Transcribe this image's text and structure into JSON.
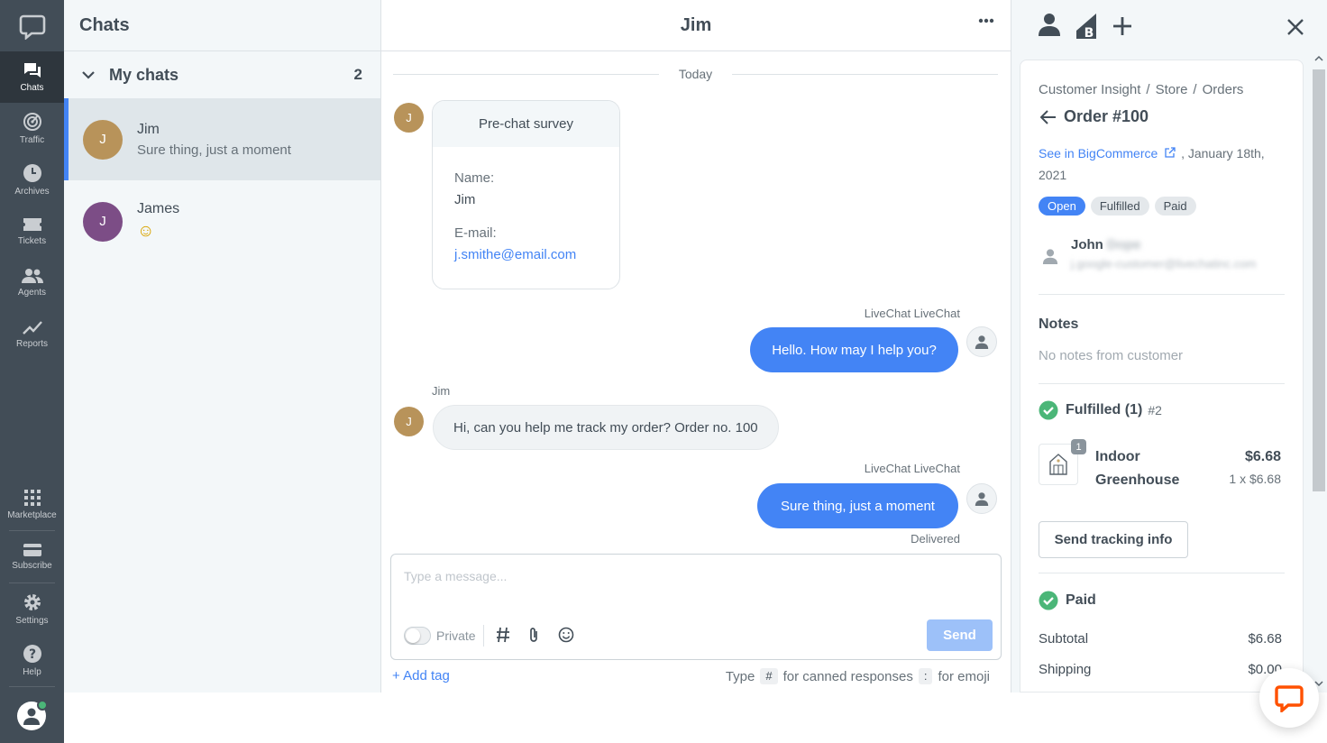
{
  "nav": {
    "items": [
      {
        "label": "Chats",
        "icon": "chats-icon"
      },
      {
        "label": "Traffic",
        "icon": "traffic-icon"
      },
      {
        "label": "Archives",
        "icon": "clock-icon"
      },
      {
        "label": "Tickets",
        "icon": "ticket-icon"
      },
      {
        "label": "Agents",
        "icon": "agents-icon"
      },
      {
        "label": "Reports",
        "icon": "reports-icon"
      }
    ],
    "bottom": [
      {
        "label": "Marketplace",
        "icon": "grid-icon"
      },
      {
        "label": "Subscribe",
        "icon": "card-icon"
      },
      {
        "label": "Settings",
        "icon": "gear-icon"
      },
      {
        "label": "Help",
        "icon": "help-icon"
      }
    ]
  },
  "list": {
    "title": "Chats",
    "group_label": "My chats",
    "group_count": "2",
    "chats": [
      {
        "initial": "J",
        "name": "Jim",
        "preview": "Sure thing, just a moment",
        "color": "#b8935a"
      },
      {
        "initial": "J",
        "name": "James",
        "preview": "☺",
        "color": "#7c4d86"
      }
    ]
  },
  "main": {
    "title": "Jim",
    "day": "Today",
    "survey": {
      "title": "Pre-chat survey",
      "name_label": "Name:",
      "name_value": "Jim",
      "email_label": "E-mail:",
      "email_value": "j.smithe@email.com"
    },
    "messages": {
      "agent_name": "LiveChat LiveChat",
      "customer_name": "Jim",
      "m1": "Hello. How may I help you?",
      "m2": "Hi, can you help me track my order? Order no. 100",
      "m3": "Sure thing, just a moment",
      "status": "Delivered"
    },
    "composer": {
      "placeholder": "Type a message...",
      "private_label": "Private",
      "send_label": "Send",
      "add_tag": "+ Add tag",
      "hint_type": "Type",
      "hint_hash": "#",
      "hint_canned": "for canned responses",
      "hint_colon": ":",
      "hint_emoji": "for emoji"
    }
  },
  "side": {
    "crumbs": [
      "Customer Insight",
      "Store",
      "Orders"
    ],
    "order_title": "Order #100",
    "see_link": "See in BigCommerce",
    "date": ", January 18th, 2021",
    "badges": [
      "Open",
      "Fulfilled",
      "Paid"
    ],
    "customer_first": "John",
    "customer_last": "Dope",
    "customer_email": "j.google-customer@livechatinc.com",
    "notes_title": "Notes",
    "notes_empty": "No notes from customer",
    "fulfilled_title": "Fulfilled (1)",
    "fulfilled_sub": "#2",
    "product": {
      "qty": "1",
      "name": "Indoor Greenhouse",
      "price": "$6.68",
      "unit": "1 x $6.68"
    },
    "track_button": "Send tracking info",
    "paid_title": "Paid",
    "subtotal_label": "Subtotal",
    "subtotal_value": "$6.68",
    "shipping_label": "Shipping",
    "shipping_value": "$0.00"
  },
  "colors": {
    "accent": "#4384f5",
    "nav": "#424d57",
    "success": "#4bb678",
    "brand_chat": "#ff5100"
  }
}
